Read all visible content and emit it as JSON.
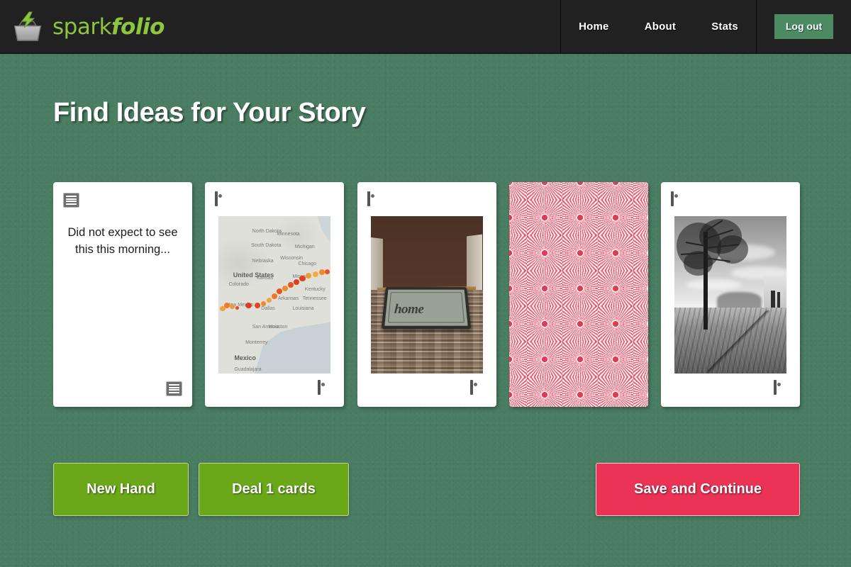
{
  "header": {
    "brand": {
      "spark": "spark",
      "folio": "folio",
      "logo_icon": "spark-box-logo"
    },
    "nav": [
      {
        "label": "Home",
        "name": "nav-home"
      },
      {
        "label": "About",
        "name": "nav-about"
      },
      {
        "label": "Stats",
        "name": "nav-stats"
      }
    ],
    "logout_label": "Log out",
    "colors": {
      "bar": "#212121",
      "logout": "#4c8a63",
      "brand": "#8cc63e"
    }
  },
  "page": {
    "title": "Find Ideas for Your Story",
    "background_color": "#4a7d62"
  },
  "cards": [
    {
      "type": "text",
      "icon": "text-lines-icon",
      "text": "Did not expect to see this this morning..."
    },
    {
      "type": "image",
      "icon": "image-icon",
      "caption": "map-heat-trail",
      "map_labels": {
        "united_states": "United States",
        "mexico": "Mexico",
        "chicago": "Chicago",
        "dallas": "Dallas",
        "houston": "Houston",
        "san_antonio": "San Antonio",
        "monterrey": "Monterrey",
        "new_mexico": "New Mexico",
        "nebraska": "Nebraska",
        "kansas": "Kansas",
        "north_dakota": "North Dakota",
        "south_dakota": "South Dakota",
        "minnesota": "Minnesota",
        "wisconsin": "Wisconsin",
        "michigan": "Michigan",
        "colorado": "Colorado",
        "missouri": "Missouri",
        "kentucky": "Kentucky",
        "tennessee": "Tennessee",
        "arkansas": "Arkansas",
        "louisiana": "Louisiana",
        "guadalajara": "Guadalajara"
      }
    },
    {
      "type": "image",
      "icon": "image-icon",
      "caption": "doormat-photo",
      "mat_word": "home"
    },
    {
      "type": "card-back",
      "icon": null,
      "caption": "pink-sunburst-pattern",
      "colors": {
        "center": "#e03a56",
        "ray": "#e8556c",
        "base": "#ec6e81"
      }
    },
    {
      "type": "image",
      "icon": "image-icon",
      "caption": "black-and-white-tree-photo"
    }
  ],
  "buttons": {
    "new_hand": "New Hand",
    "deal": "Deal 1 cards",
    "save": "Save and Continue",
    "colors": {
      "green": "#6aa81a",
      "pink": "#ea3355"
    }
  }
}
